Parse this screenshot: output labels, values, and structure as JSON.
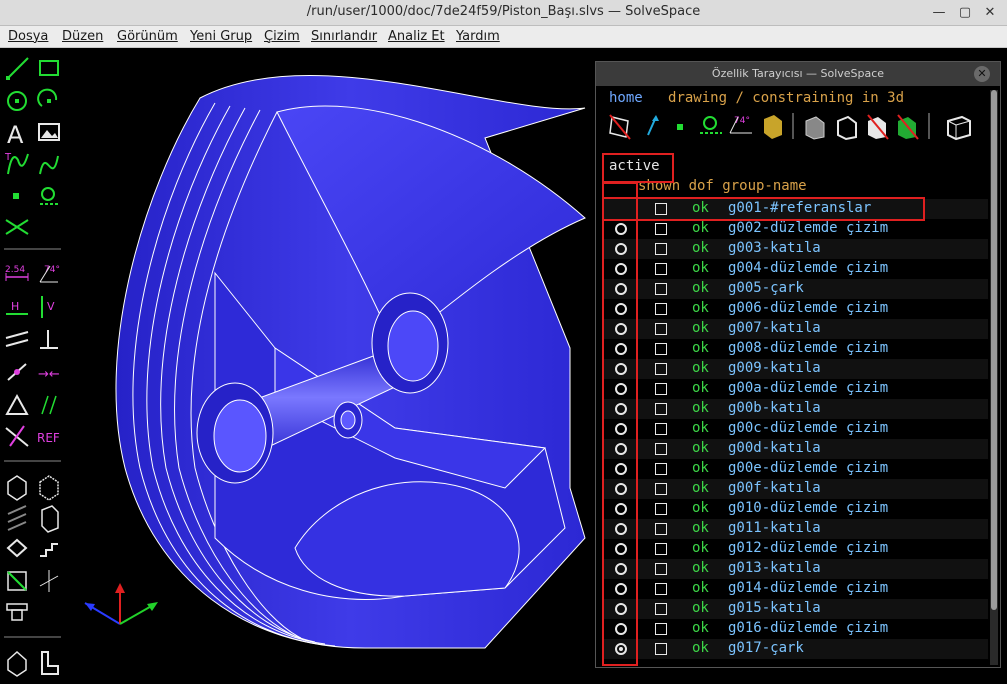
{
  "window": {
    "title": "/run/user/1000/doc/7de24f59/Piston_Başı.slvs — SolveSpace"
  },
  "menu": {
    "items": [
      "Dosya",
      "Düzen",
      "Görünüm",
      "Yeni Grup",
      "Çizim",
      "Sınırlandır",
      "Analiz Et",
      "Yardım"
    ]
  },
  "toolbar": {
    "tools": [
      "line-icon",
      "rectangle-icon",
      "circle-icon",
      "arc-icon",
      "text-icon",
      "image-icon",
      "tangent-arc-icon",
      "bezier-icon",
      "point-icon",
      "workplane-icon",
      "construction-icon",
      "distance-icon",
      "angle-icon",
      "horizontal-icon",
      "vertical-icon",
      "parallel-icon",
      "perpendicular-icon",
      "on-point-icon",
      "midpoint-icon",
      "equal-icon",
      "symmetric-icon",
      "reference-icon",
      "nearest-iso-icon",
      "nearest-ortho-icon",
      "hidden-lines-icon",
      "outline-icon",
      "extrude-icon",
      "step-icon",
      "section-icon",
      "axis-icon",
      "tool-icon",
      "solid-icon",
      "sketch-icon"
    ],
    "dimension_label": "2.54",
    "angle_label": "74°",
    "ref_label": "REF",
    "h_label": "H",
    "v_label": "V"
  },
  "panel": {
    "title": "Özellik Tarayıcısı — SolveSpace",
    "nav_home": "home",
    "nav_context": "drawing / constraining in 3d",
    "angle_label": "74°",
    "header_active": "active",
    "header_cols": "shown dof group-name",
    "rows": [
      {
        "dof": "ok",
        "name": "g001-#referanslar",
        "active": false
      },
      {
        "dof": "ok",
        "name": "g002-düzlemde çizim",
        "active": false
      },
      {
        "dof": "ok",
        "name": "g003-katıla",
        "active": false
      },
      {
        "dof": "ok",
        "name": "g004-düzlemde çizim",
        "active": false
      },
      {
        "dof": "ok",
        "name": "g005-çark",
        "active": false
      },
      {
        "dof": "ok",
        "name": "g006-düzlemde çizim",
        "active": false
      },
      {
        "dof": "ok",
        "name": "g007-katıla",
        "active": false
      },
      {
        "dof": "ok",
        "name": "g008-düzlemde çizim",
        "active": false
      },
      {
        "dof": "ok",
        "name": "g009-katıla",
        "active": false
      },
      {
        "dof": "ok",
        "name": "g00a-düzlemde çizim",
        "active": false
      },
      {
        "dof": "ok",
        "name": "g00b-katıla",
        "active": false
      },
      {
        "dof": "ok",
        "name": "g00c-düzlemde çizim",
        "active": false
      },
      {
        "dof": "ok",
        "name": "g00d-katıla",
        "active": false
      },
      {
        "dof": "ok",
        "name": "g00e-düzlemde çizim",
        "active": false
      },
      {
        "dof": "ok",
        "name": "g00f-katıla",
        "active": false
      },
      {
        "dof": "ok",
        "name": "g010-düzlemde çizim",
        "active": false
      },
      {
        "dof": "ok",
        "name": "g011-katıla",
        "active": false
      },
      {
        "dof": "ok",
        "name": "g012-düzlemde çizim",
        "active": false
      },
      {
        "dof": "ok",
        "name": "g013-katıla",
        "active": false
      },
      {
        "dof": "ok",
        "name": "g014-düzlemde çizim",
        "active": false
      },
      {
        "dof": "ok",
        "name": "g015-katıla",
        "active": false
      },
      {
        "dof": "ok",
        "name": "g016-düzlemde çizim",
        "active": false
      },
      {
        "dof": "ok",
        "name": "g017-çark",
        "active": true
      }
    ]
  },
  "colors": {
    "solid": "#3a36e8",
    "edge": "#ffffff",
    "axis_x": "#2a3bff",
    "axis_y": "#e02020",
    "axis_z": "#22d22a",
    "highlight": "#e02020"
  }
}
